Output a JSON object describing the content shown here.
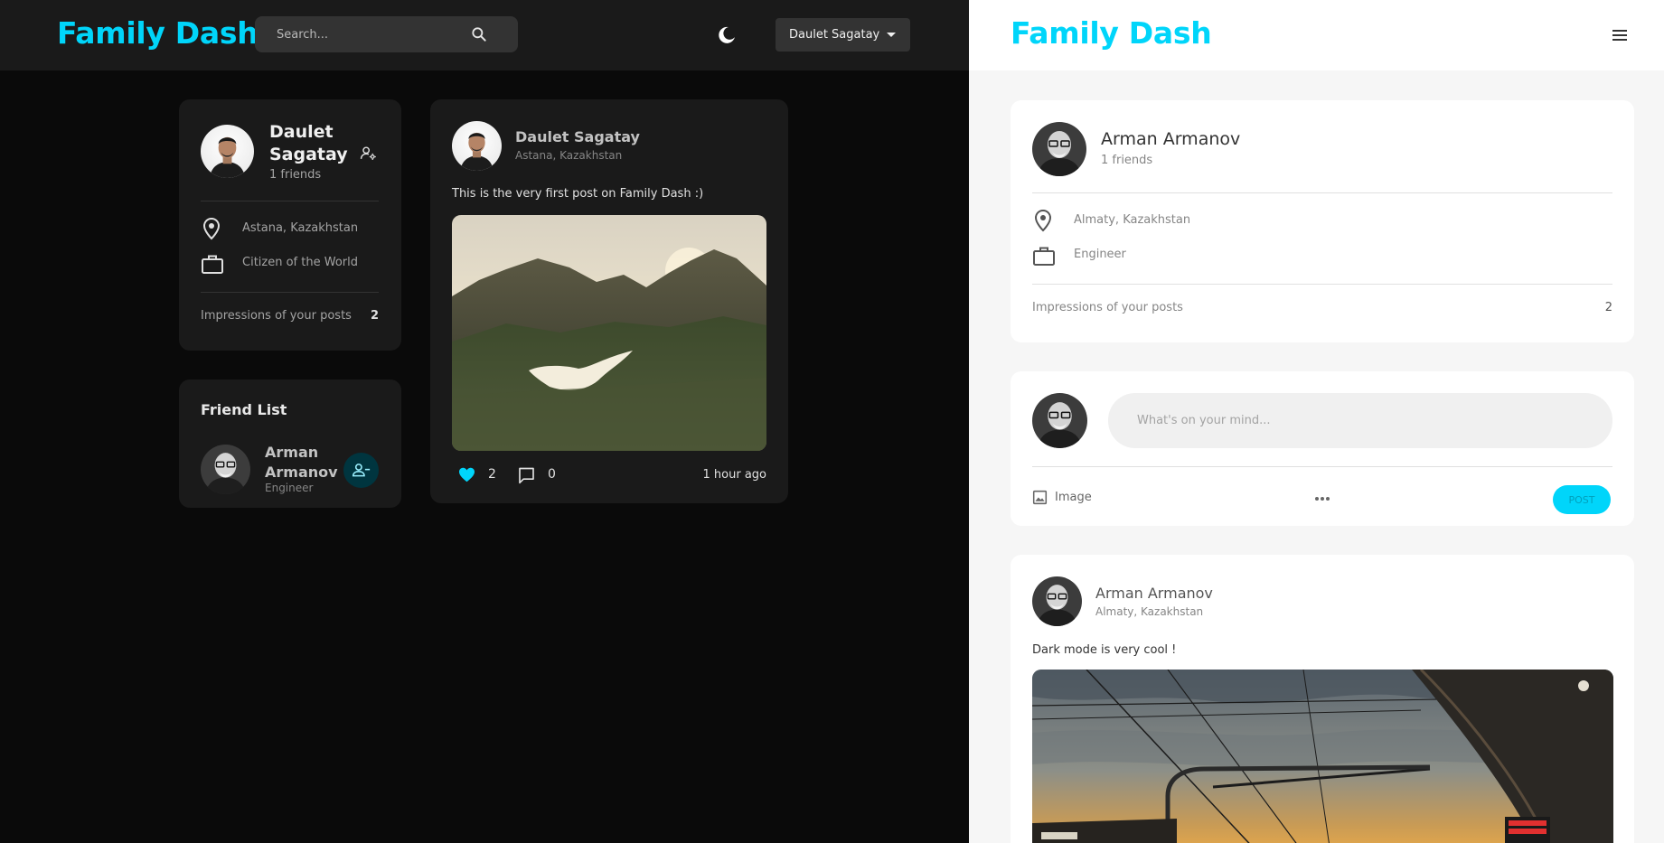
{
  "app": {
    "brand": "Family Dash"
  },
  "dark_view": {
    "search": {
      "placeholder": "Search..."
    },
    "user_menu": {
      "label": "Daulet Sagatay"
    },
    "profile": {
      "name_line1": "Daulet",
      "name_line2": "Sagatay",
      "friends": "1 friends",
      "location": "Astana, Kazakhstan",
      "occupation": "Citizen of the World",
      "impressions_label": "Impressions of your posts",
      "impressions_value": "2"
    },
    "friend_list": {
      "title": "Friend List",
      "friends": [
        {
          "name_line1": "Arman",
          "name_line2": "Armanov",
          "subtitle": "Engineer"
        }
      ]
    },
    "post": {
      "author": "Daulet Sagatay",
      "location": "Astana, Kazakhstan",
      "text": "This is the very first post on Family Dash :)",
      "likes": "2",
      "comments": "0",
      "time": "1 hour ago"
    }
  },
  "light_view": {
    "profile": {
      "name": "Arman Armanov",
      "friends": "1 friends",
      "location": "Almaty, Kazakhstan",
      "occupation": "Engineer",
      "impressions_label": "Impressions of your posts",
      "impressions_value": "2"
    },
    "composer": {
      "placeholder": "What's on your mind...",
      "image_label": "Image",
      "post_label": "POST"
    },
    "post": {
      "author": "Arman Armanov",
      "location": "Almaty, Kazakhstan",
      "text": "Dark mode is very cool !"
    }
  },
  "colors": {
    "brand": "#00d5fa",
    "dark_bg": "#0a0a0a",
    "dark_card": "#1a1a1a",
    "light_card": "#ffffff"
  }
}
